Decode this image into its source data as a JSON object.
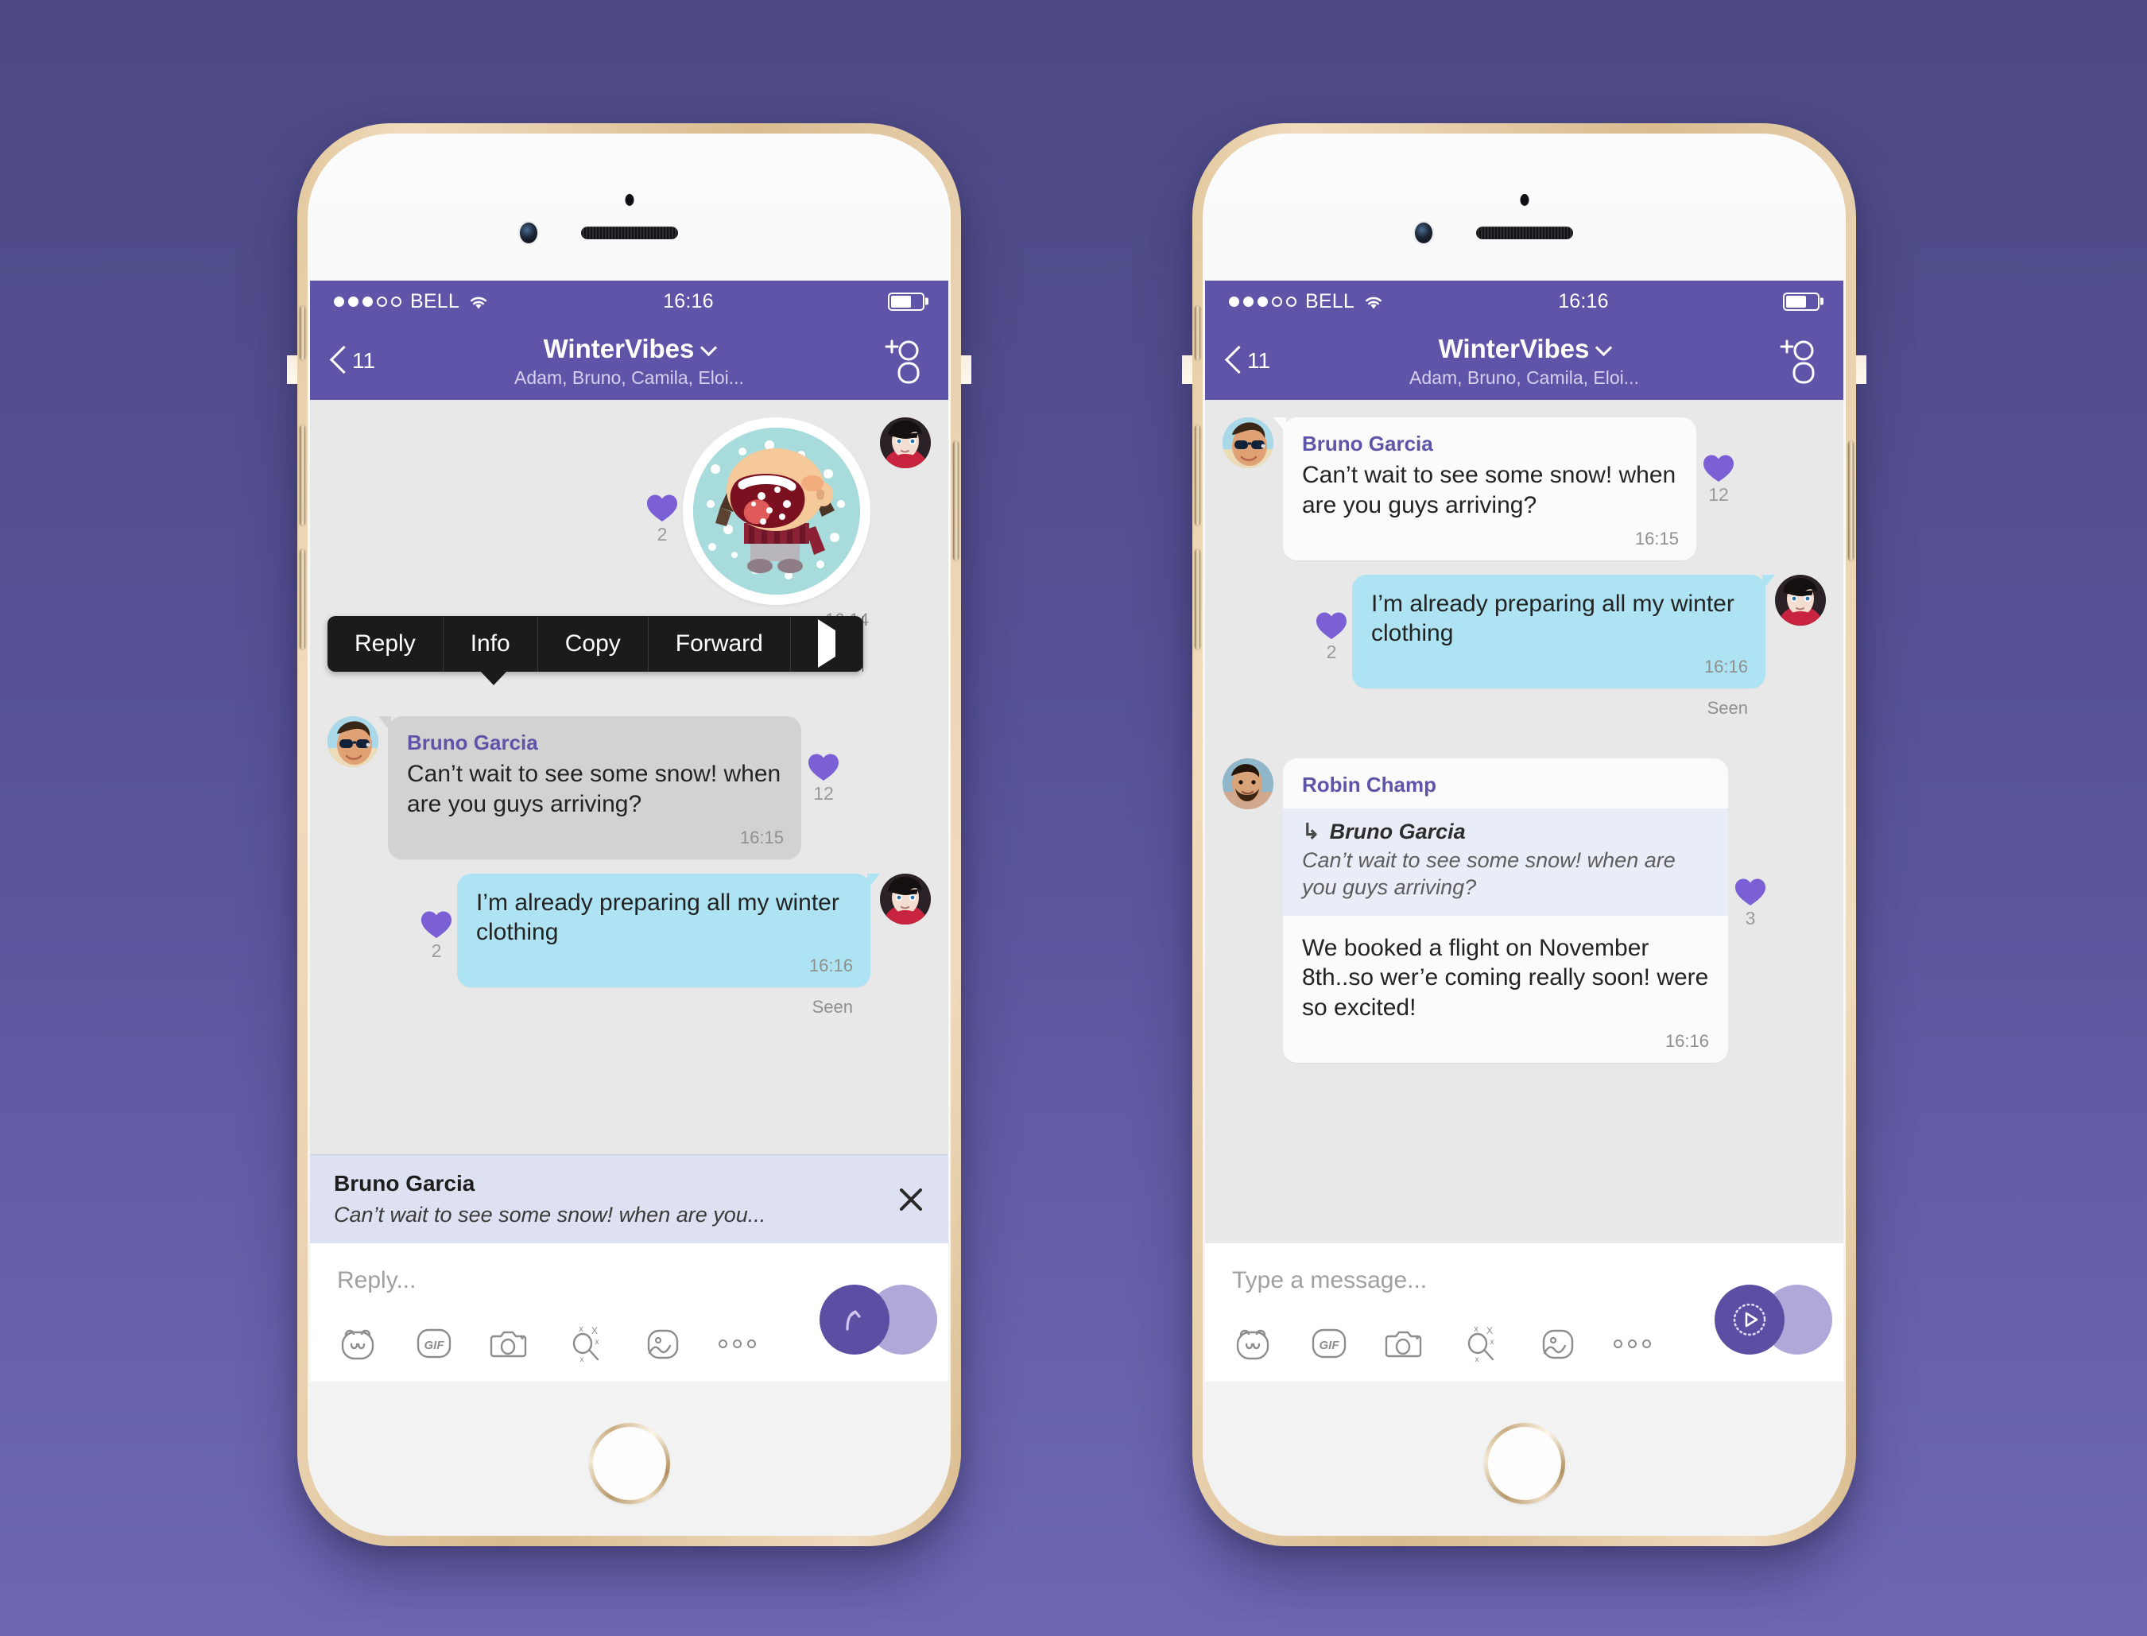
{
  "theme": {
    "bg_top": "#4d4a85",
    "bg_bottom": "#6e68b4",
    "navbar": "#5f55a8",
    "accent_purple": "#5f55a8",
    "heart": "#7b5fd4",
    "bubble_in_gray": "#d2d2d2",
    "bubble_in_white": "#fbfbfb",
    "bubble_out_blue": "#ade3f2",
    "chat_bg": "#e8e8e8",
    "reply_bar_bg": "#dde1f2",
    "quote_bg": "#e8edf7",
    "menu_bg": "#1b1b1b"
  },
  "status_bar": {
    "carrier": "BELL",
    "signal_filled": 3,
    "signal_empty": 2,
    "wifi_icon": "wifi-icon",
    "time": "16:16",
    "battery_icon": "battery-icon",
    "battery_percent": 65
  },
  "nav": {
    "back_count": "11",
    "back_icon": "chevron-left-icon",
    "title": "WinterVibes",
    "title_chevron_icon": "chevron-down-icon",
    "subtitle": "Adam, Bruno, Camila, Eloi...",
    "add_person_icon": "add-person-icon"
  },
  "phone_left": {
    "label": "phone-left",
    "sticker_message": {
      "sticker_icon": "snow-globe-sticker",
      "alt": "snow globe with character catching snowflakes",
      "time": "16:14",
      "reaction": {
        "icon": "heart-icon",
        "count": "2"
      },
      "avatar": "avatar-me"
    },
    "context_menu": {
      "items": [
        {
          "label": "Reply",
          "name": "context-menu-reply"
        },
        {
          "label": "Info",
          "name": "context-menu-info"
        },
        {
          "label": "Copy",
          "name": "context-menu-copy"
        },
        {
          "label": "Forward",
          "name": "context-menu-forward"
        }
      ],
      "more_icon": "play-arrow-icon"
    },
    "messages": [
      {
        "type": "incoming",
        "sender": "Bruno Garcia",
        "text": "Can’t wait to see some snow! when are you guys arriving?",
        "time": "16:15",
        "avatar": "avatar-bruno",
        "reaction": {
          "icon": "heart-icon",
          "count": "12"
        }
      },
      {
        "type": "outgoing",
        "text": "I’m already preparing all my winter clothing",
        "time": "16:16",
        "status": "Seen",
        "avatar": "avatar-me",
        "reaction": {
          "icon": "heart-icon",
          "count": "2"
        }
      }
    ],
    "reply_preview": {
      "name": "Bruno Garcia",
      "text": "Can’t wait to see some snow! when are you...",
      "close_icon": "close-icon"
    },
    "composer": {
      "placeholder": "Reply...",
      "tools": [
        {
          "label": "sticker-icon",
          "name": "sticker-button"
        },
        {
          "label": "gif-icon",
          "name": "gif-button"
        },
        {
          "label": "camera-icon",
          "name": "camera-button"
        },
        {
          "label": "magic-search-icon",
          "name": "search-button"
        },
        {
          "label": "doodle-icon",
          "name": "doodle-button"
        },
        {
          "label": "more-icon",
          "name": "more-button"
        }
      ],
      "send_icon": "reply-arrow-icon",
      "send_name": "send-reply-button"
    }
  },
  "phone_right": {
    "label": "phone-right",
    "messages": [
      {
        "type": "incoming",
        "sender": "Bruno Garcia",
        "text": "Can’t wait to see some snow! when are you guys arriving?",
        "time": "16:15",
        "avatar": "avatar-bruno",
        "reaction": {
          "icon": "heart-icon",
          "count": "12"
        }
      },
      {
        "type": "outgoing",
        "text": "I’m already preparing all my winter clothing",
        "time": "16:16",
        "status": "Seen",
        "avatar": "avatar-me",
        "reaction": {
          "icon": "heart-icon",
          "count": "2"
        }
      },
      {
        "type": "incoming-quoted",
        "sender": "Robin Champ",
        "quote_arrow_icon": "reply-corner-icon",
        "quote_name": "Bruno Garcia",
        "quote_text": "Can’t wait to see some snow! when are you guys arriving?",
        "text": "We booked a flight on November 8th..so wer’e coming really soon! were so excited!",
        "time": "16:16",
        "avatar": "avatar-robin",
        "reaction": {
          "icon": "heart-icon",
          "count": "3"
        }
      }
    ],
    "composer": {
      "placeholder": "Type a message...",
      "tools": [
        {
          "label": "sticker-icon",
          "name": "sticker-button"
        },
        {
          "label": "gif-icon",
          "name": "gif-button"
        },
        {
          "label": "camera-icon",
          "name": "camera-button"
        },
        {
          "label": "magic-search-icon",
          "name": "search-button"
        },
        {
          "label": "doodle-icon",
          "name": "doodle-button"
        },
        {
          "label": "more-icon",
          "name": "more-button"
        }
      ],
      "send_icon": "voice-play-icon",
      "send_name": "send-voice-button"
    }
  }
}
